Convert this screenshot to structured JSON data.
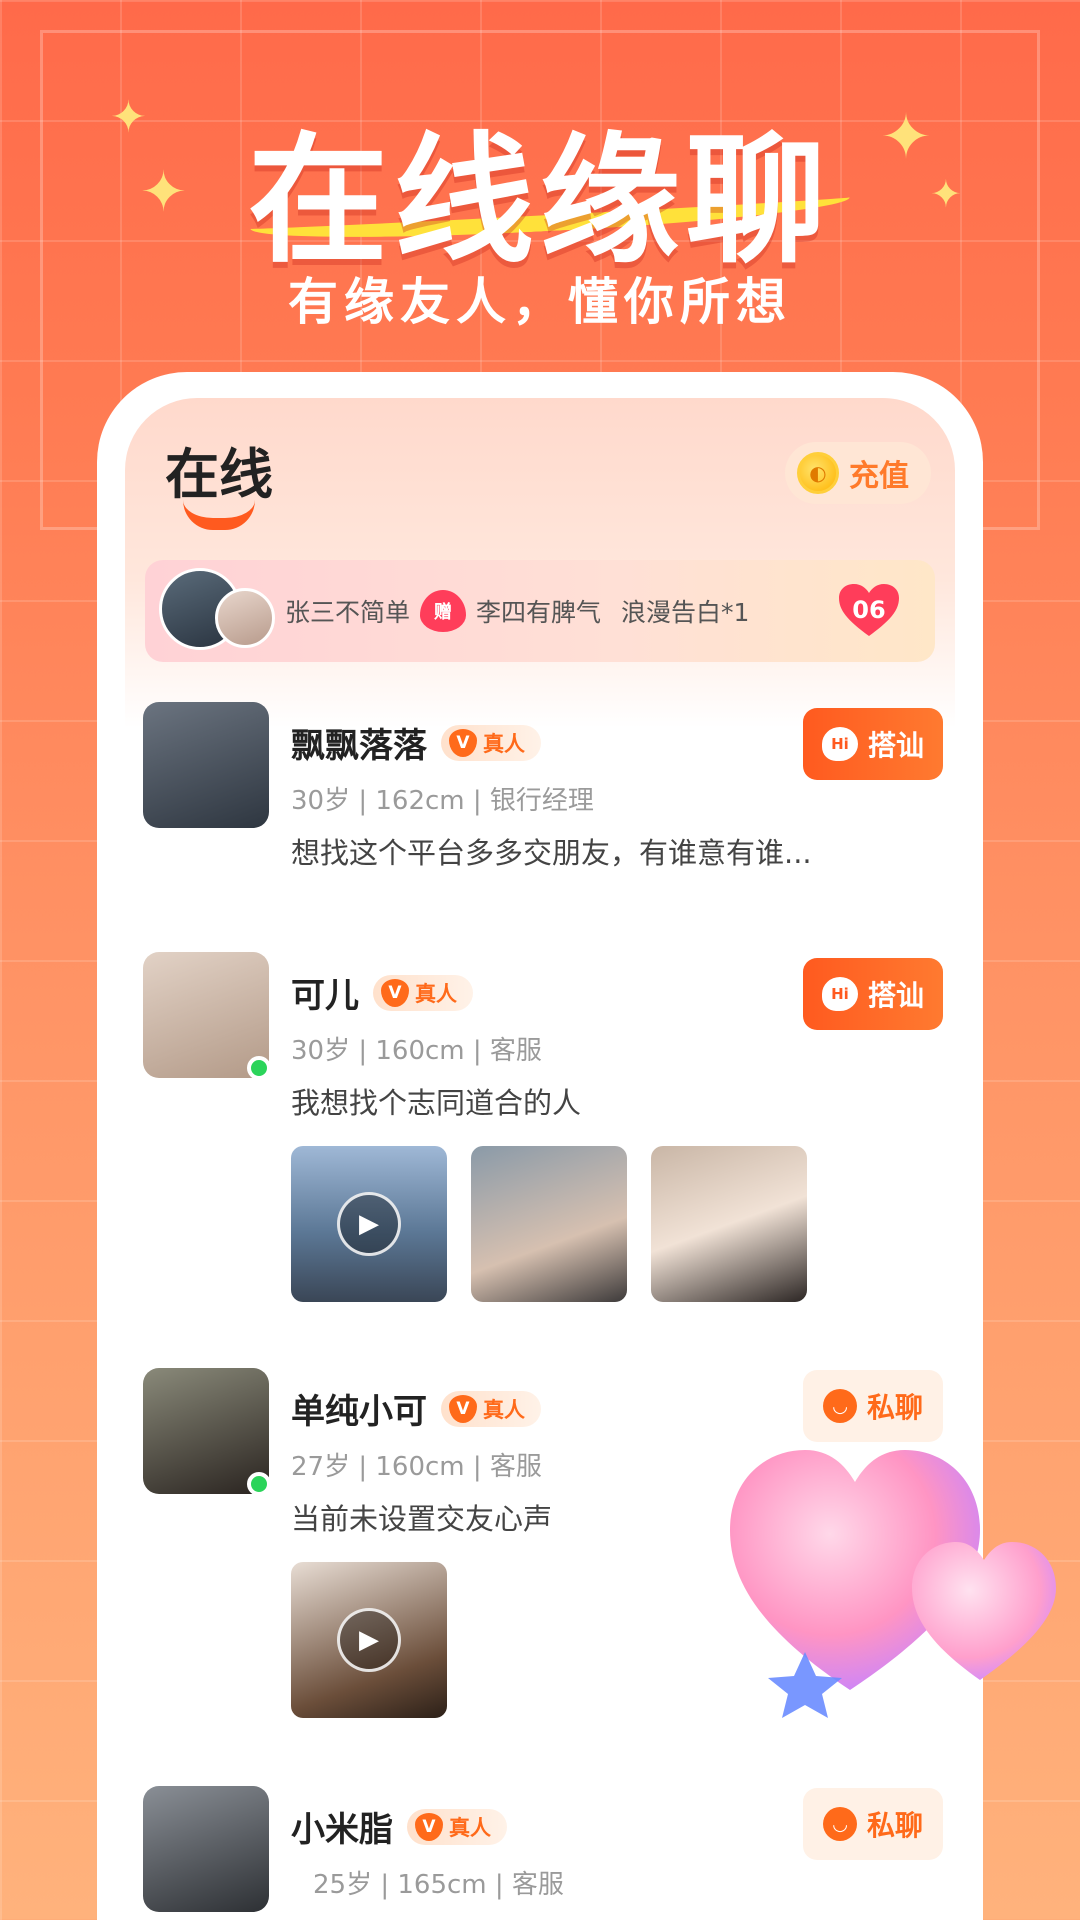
{
  "hero": {
    "title": "在线缘聊",
    "subtitle": "有缘友人，懂你所想"
  },
  "header": {
    "logo_text": "在线",
    "recharge_label": "充值"
  },
  "gift_banner": {
    "sender": "张三不简单",
    "gift_icon_label": "赠",
    "receiver": "李四有脾气",
    "gift": "浪漫告白*1",
    "count": "06"
  },
  "real_badge_label": "真人",
  "actions": {
    "hi_label": "搭讪",
    "chat_label": "私聊"
  },
  "feed": [
    {
      "name": "飘飘落落",
      "meta": "30岁 | 162cm | 银行经理",
      "bio": "想找这个平台多多交朋友，有谁意有谁...",
      "action": "hi",
      "online": false
    },
    {
      "name": "可儿",
      "meta": "30岁 | 160cm | 客服",
      "bio": "我想找个志同道合的人",
      "action": "hi",
      "online": true
    },
    {
      "name": "单纯小可",
      "meta": "27岁 | 160cm | 客服",
      "bio": "当前未设置交友心声",
      "action": "chat",
      "online": true
    },
    {
      "name": "小米脂",
      "meta": "25岁 | 165cm | 客服",
      "bio": "",
      "action": "chat",
      "online": false
    }
  ],
  "colors": {
    "accent": "#ff5a1f",
    "background_top": "#ff6a4a",
    "background_bottom": "#ffb27c",
    "online": "#2bd45a"
  }
}
